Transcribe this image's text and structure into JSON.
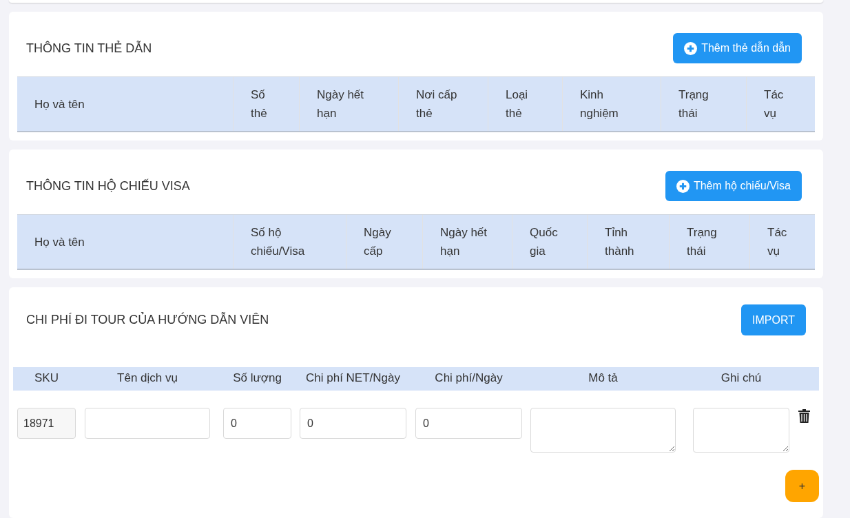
{
  "guide_cards": {
    "title": "THÔNG TIN THẺ DẪN",
    "add_button": "Thêm thẻ dẫn dẫn",
    "columns": [
      "Họ và tên",
      "Số thẻ",
      "Ngày hết hạn",
      "Nơi cấp thẻ",
      "Loại thẻ",
      "Kinh nghiệm",
      "Trạng thái",
      "Tác vụ"
    ]
  },
  "passport_visa": {
    "title": "THÔNG TIN HỘ CHIẾU VISA",
    "add_button": "Thêm hộ chiếu/Visa",
    "columns": [
      "Họ và tên",
      "Số hộ chiếu/Visa",
      "Ngày cấp",
      "Ngày hết hạn",
      "Quốc gia",
      "Tỉnh thành",
      "Trạng thái",
      "Tác vụ"
    ]
  },
  "tour_costs": {
    "title": "CHI PHÍ ĐI TOUR CỦA HƯỚNG DẪN VIÊN",
    "import_button": "IMPORT",
    "columns": [
      "SKU",
      "Tên dịch vụ",
      "Số lượng",
      "Chi phí NET/Ngày",
      "Chi phí/Ngày",
      "Mô tả",
      "Ghi chú"
    ],
    "rows": [
      {
        "fields": [
          {
            "kind": "readonly",
            "value": "18971"
          },
          {
            "kind": "input"
          },
          {
            "kind": "input",
            "value": "0"
          },
          {
            "kind": "input",
            "value": "0"
          },
          {
            "kind": "input",
            "value": "0"
          },
          {
            "kind": "textarea"
          },
          {
            "kind": "textarea"
          }
        ]
      }
    ],
    "add_row_button": "+"
  }
}
